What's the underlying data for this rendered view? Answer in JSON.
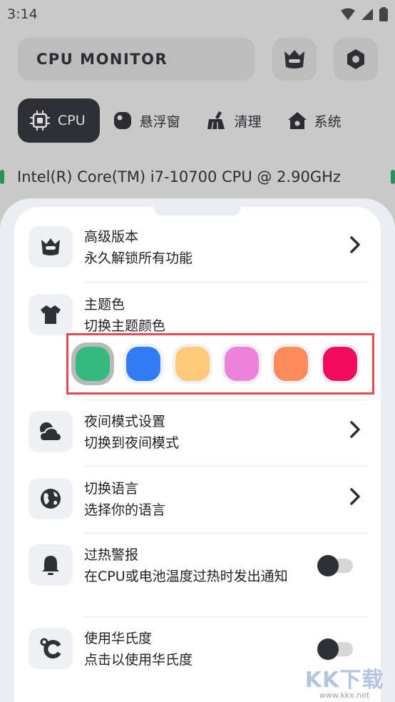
{
  "status_bar": {
    "time": "3:14",
    "icons": [
      "wifi-icon",
      "signal-icon",
      "battery-icon"
    ]
  },
  "header": {
    "title": "CPU MONITOR",
    "buttons": [
      {
        "icon": "crown-icon"
      },
      {
        "icon": "settings-icon"
      }
    ]
  },
  "tabs": [
    {
      "label": "CPU",
      "icon": "chip-icon",
      "active": true
    },
    {
      "label": "悬浮窗",
      "icon": "floating-window-icon",
      "active": false
    },
    {
      "label": "清理",
      "icon": "broom-icon",
      "active": false
    },
    {
      "label": "系统",
      "icon": "home-icon",
      "active": false
    }
  ],
  "cpu_info": "Intel(R) Core(TM) i7-10700 CPU @ 2.90GHz",
  "settings": {
    "premium": {
      "title": "高级版本",
      "subtitle": "永久解锁所有功能",
      "icon": "crown-icon"
    },
    "theme": {
      "title": "主题色",
      "subtitle": "切换主题颜色",
      "icon": "shirt-icon",
      "colors": [
        "#34b97e",
        "#2f7cf6",
        "#ffc97a",
        "#ec82d9",
        "#ff8a5c",
        "#f20a5c"
      ],
      "selected_index": 0
    },
    "night_mode": {
      "title": "夜间模式设置",
      "subtitle": "切换到夜间模式",
      "icon": "cloud-moon-icon"
    },
    "language": {
      "title": "切换语言",
      "subtitle": "选择你的语言",
      "icon": "globe-icon"
    },
    "overheat": {
      "title": "过热警报",
      "subtitle": "在CPU或电池温度过热时发出通知",
      "icon": "bell-icon",
      "enabled": false
    },
    "fahrenheit": {
      "title": "使用华氏度",
      "subtitle": "点击以使用华氏度",
      "icon": "fahrenheit-icon",
      "enabled": false
    }
  },
  "watermark": {
    "logo": "KK下载",
    "url": "www.kkx.net"
  },
  "colors": {
    "accent": "#2f2f36",
    "sheet_bg": "#eaedf2",
    "dim_bg": "#c9c9c9",
    "highlight": "#e5484d"
  }
}
